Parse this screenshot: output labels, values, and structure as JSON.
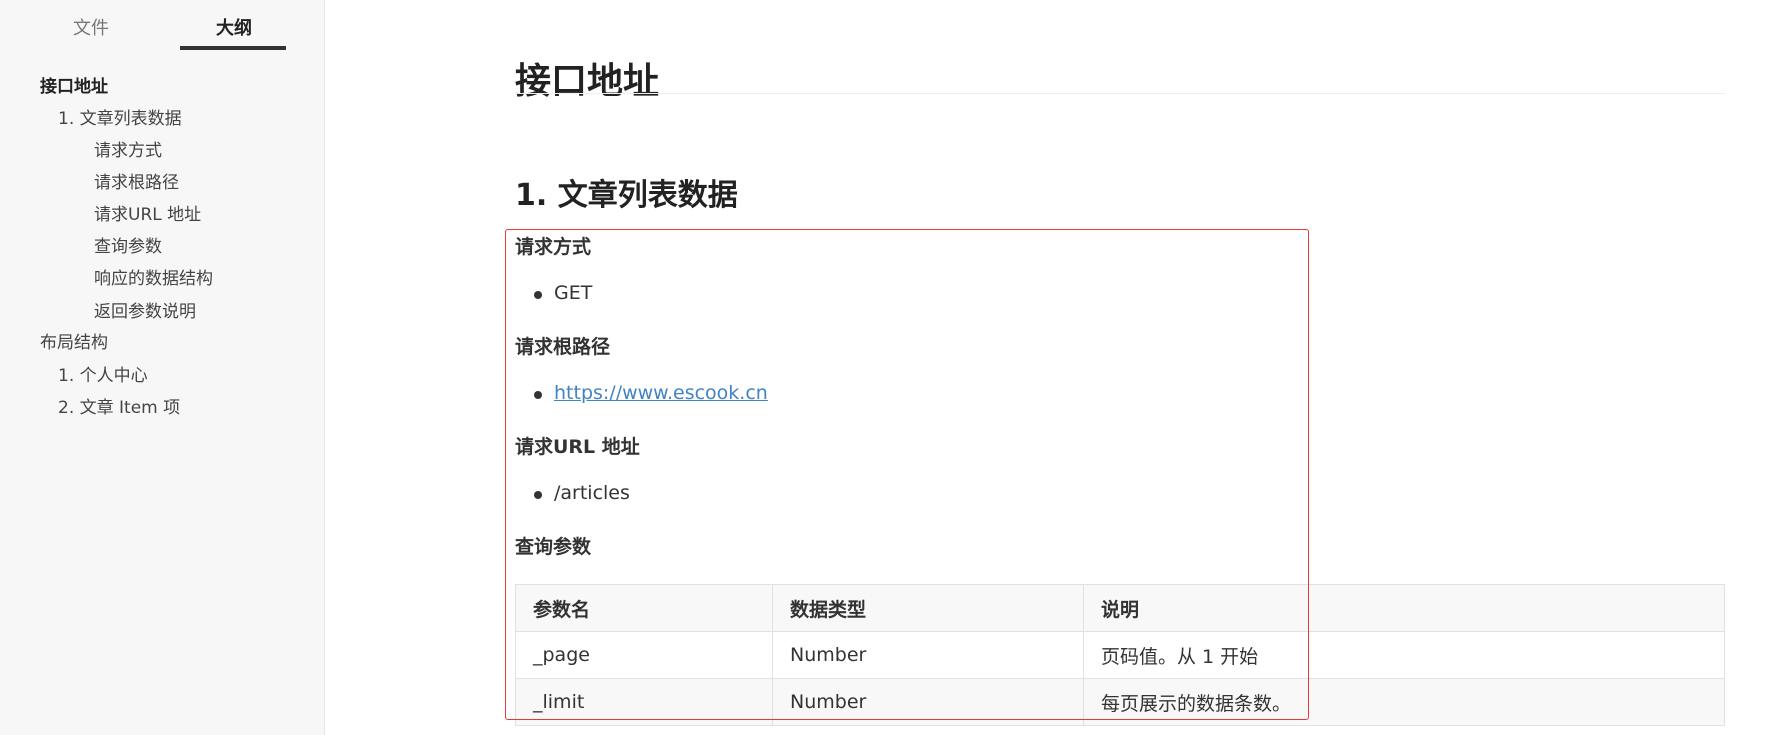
{
  "sidebar": {
    "tabs": [
      {
        "label": "文件"
      },
      {
        "label": "大纲"
      }
    ],
    "outline": [
      {
        "label": "接口地址"
      },
      {
        "label": "1. 文章列表数据"
      },
      {
        "label": "请求方式"
      },
      {
        "label": "请求根路径"
      },
      {
        "label": "请求URL 地址"
      },
      {
        "label": "查询参数"
      },
      {
        "label": "响应的数据结构"
      },
      {
        "label": "返回参数说明"
      },
      {
        "label": "布局结构"
      },
      {
        "label": "1. 个人中心"
      },
      {
        "label": "2. 文章 Item 项"
      }
    ]
  },
  "doc": {
    "h1": "接口地址",
    "h2": "1. 文章列表数据",
    "sections": [
      {
        "heading": "请求方式",
        "item": "GET"
      },
      {
        "heading": "请求根路径",
        "item": "https://www.escook.cn"
      },
      {
        "heading": "请求URL 地址",
        "item": "/articles"
      },
      {
        "heading": "查询参数"
      }
    ],
    "table": {
      "headers": [
        "参数名",
        "数据类型",
        "说明"
      ],
      "rows": [
        [
          "_page",
          "Number",
          "页码值。从 1 开始"
        ],
        [
          "_limit",
          "Number",
          "每页展示的数据条数。"
        ]
      ]
    }
  },
  "colors": {
    "link": "#4183c4",
    "highlight_border": "#e53935",
    "sidebar_bg": "#f7f7f7"
  }
}
